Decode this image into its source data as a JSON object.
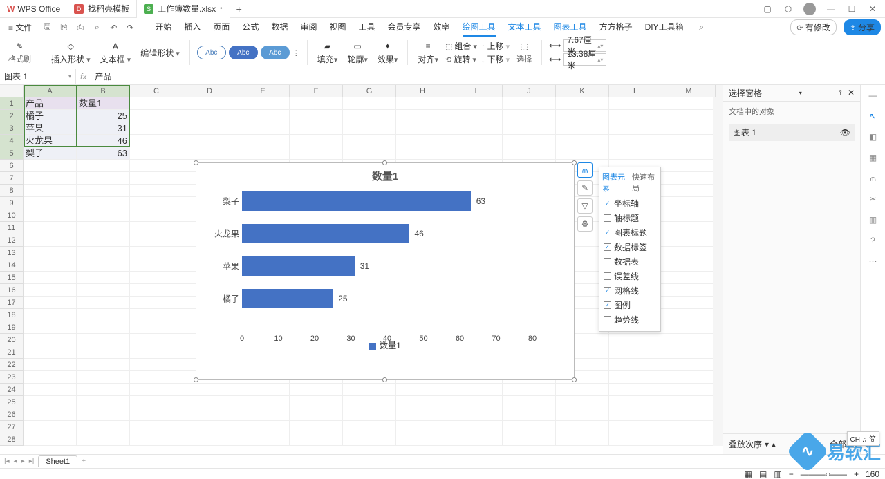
{
  "titlebar": {
    "brand": "WPS Office",
    "tabs": [
      {
        "label": "找稻壳模板"
      },
      {
        "label": "工作簿数量.xlsx"
      }
    ],
    "active_tab": 1
  },
  "menubar": {
    "file": "文件",
    "tabs": [
      "开始",
      "插入",
      "页面",
      "公式",
      "数据",
      "审阅",
      "视图",
      "工具",
      "会员专享",
      "效率",
      "绘图工具",
      "文本工具",
      "图表工具",
      "方方格子",
      "DIY工具箱"
    ],
    "active": 10,
    "right": {
      "modify": "有修改",
      "share": "分享"
    }
  },
  "ribbon": {
    "g1": "格式刷",
    "g2a": "插入形状",
    "g2b": "编辑形状",
    "g3": "文本框",
    "shape_label": "Abc",
    "fill": "填充",
    "outline": "轮廓",
    "effect": "效果",
    "align": "对齐",
    "group": "组合",
    "rotate": "旋转",
    "up": "上移",
    "down": "下移",
    "select": "选择",
    "width": "7.67厘米",
    "height": "13.38厘米"
  },
  "namebox": "图表 1",
  "formula_prefix": "产品",
  "columns": [
    "A",
    "B",
    "C",
    "D",
    "E",
    "F",
    "G",
    "H",
    "I",
    "J",
    "K",
    "L",
    "M"
  ],
  "table": {
    "headers": [
      "产品",
      "数量1"
    ],
    "rows": [
      [
        "橘子",
        "25"
      ],
      [
        "苹果",
        "31"
      ],
      [
        "火龙果",
        "46"
      ],
      [
        "梨子",
        "63"
      ]
    ]
  },
  "chart_data": {
    "type": "bar",
    "title": "数量1",
    "xlabel": "",
    "ylabel": "",
    "categories": [
      "梨子",
      "火龙果",
      "苹果",
      "橘子"
    ],
    "values": [
      63,
      46,
      31,
      25
    ],
    "xlim": [
      0,
      80
    ],
    "xticks": [
      0,
      10,
      20,
      30,
      40,
      50,
      60,
      70,
      80
    ],
    "legend": "数量1",
    "series_color": "#4472c4"
  },
  "popup": {
    "tabs": [
      "图表元素",
      "快速布局"
    ],
    "active": 0,
    "items": [
      {
        "label": "坐标轴",
        "checked": true
      },
      {
        "label": "轴标题",
        "checked": false
      },
      {
        "label": "图表标题",
        "checked": true
      },
      {
        "label": "数据标签",
        "checked": true
      },
      {
        "label": "数据表",
        "checked": false
      },
      {
        "label": "误差线",
        "checked": false
      },
      {
        "label": "网格线",
        "checked": true
      },
      {
        "label": "图例",
        "checked": true
      },
      {
        "label": "趋势线",
        "checked": false
      }
    ]
  },
  "rightpane": {
    "title": "选择窗格",
    "sub": "文档中的对象",
    "item": "图表 1",
    "foot_a": "叠放次序",
    "foot_b": "全部显"
  },
  "sheetbar": {
    "sheets": [
      "Sheet1"
    ]
  },
  "statusbar": {
    "zoom": "160"
  },
  "ime": "CH ♫ 简",
  "watermark": "易软汇"
}
